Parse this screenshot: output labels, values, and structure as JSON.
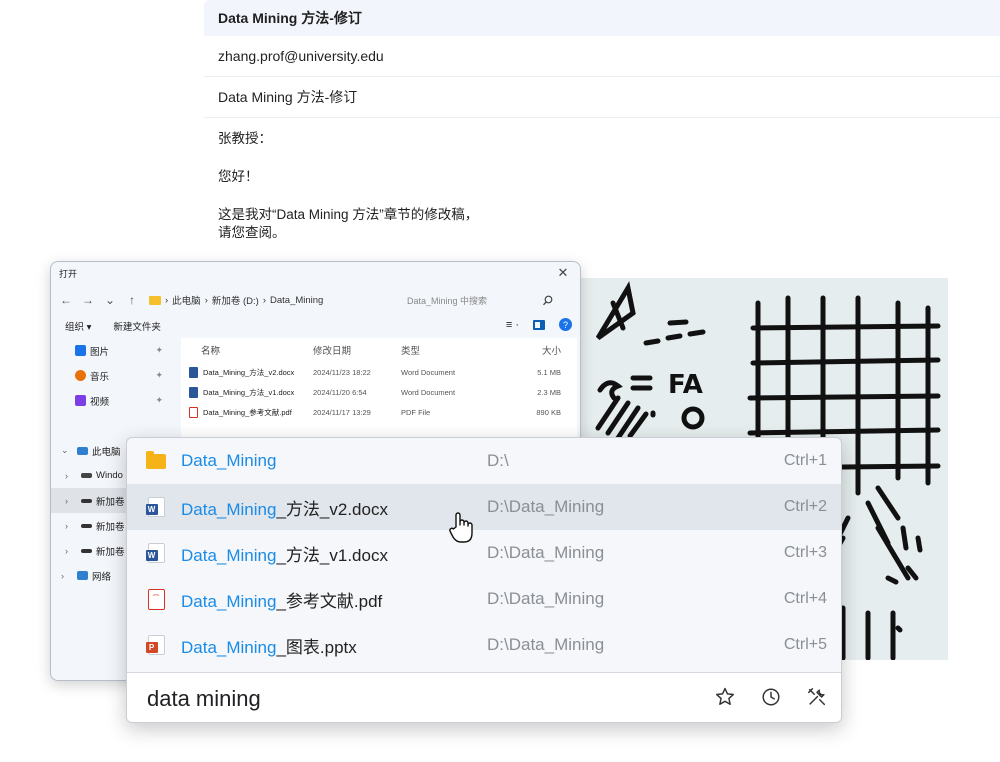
{
  "email": {
    "subject_header": "Data Mining 方法-修订",
    "to": "zhang.prof@university.edu",
    "subject": "Data Mining 方法-修订",
    "body": [
      "张教授：",
      "您好！",
      "这是我对“Data Mining 方法”章节的修改稿，",
      "请您查阅。"
    ]
  },
  "explorer": {
    "title": "打开",
    "close": "✕",
    "nav": {
      "back": "←",
      "forward": "→",
      "down": "⌄",
      "up": "↑"
    },
    "path": [
      "此电脑",
      "新加卷 (D:)",
      "Data_Mining"
    ],
    "search_placeholder": "Data_Mining 中搜索",
    "commands": {
      "organize": "组织 ▾",
      "new_folder": "新建文件夹"
    },
    "quick_access": [
      {
        "label": "图片",
        "color": "#1a73e8"
      },
      {
        "label": "音乐",
        "color": "#e8710a"
      },
      {
        "label": "视频",
        "color": "#7b3fe4"
      }
    ],
    "tree": [
      {
        "label": "此电脑",
        "chev": "⌄"
      },
      {
        "label": "Windo",
        "chev": "›"
      },
      {
        "label": "新加卷",
        "chev": "›",
        "selected": true
      },
      {
        "label": "新加卷",
        "chev": "›"
      },
      {
        "label": "新加卷",
        "chev": "›"
      },
      {
        "label": "网络",
        "chev": "›"
      }
    ],
    "columns": {
      "name": "名称",
      "date": "修改日期",
      "type": "类型",
      "size": "大小"
    },
    "files": [
      {
        "name": "Data_Mining_方法_v2.docx",
        "date": "2024/11/23 18:22",
        "type": "Word Document",
        "size": "5.1 MB",
        "kind": "word"
      },
      {
        "name": "Data_Mining_方法_v1.docx",
        "date": "2024/11/20 6:54",
        "type": "Word Document",
        "size": "2.3 MB",
        "kind": "word"
      },
      {
        "name": "Data_Mining_参考文献.pdf",
        "date": "2024/11/17 13:29",
        "type": "PDF File",
        "size": "890 KB",
        "kind": "pdf"
      }
    ]
  },
  "launcher": {
    "results": [
      {
        "match": "Data_Mining",
        "rest": "",
        "path": "D:\\",
        "shortcut": "Ctrl+1",
        "kind": "folder"
      },
      {
        "match": "Data_Mining",
        "rest": "_方法_v2.docx",
        "path": "D:\\Data_Mining",
        "shortcut": "Ctrl+2",
        "kind": "word",
        "selected": true
      },
      {
        "match": "Data_Mining",
        "rest": "_方法_v1.docx",
        "path": "D:\\Data_Mining",
        "shortcut": "Ctrl+3",
        "kind": "word"
      },
      {
        "match": "Data_Mining",
        "rest": "_参考文献.pdf",
        "path": "D:\\Data_Mining",
        "shortcut": "Ctrl+4",
        "kind": "pdf"
      },
      {
        "match": "Data_Mining",
        "rest": "_图表.pptx",
        "path": "D:\\Data_Mining",
        "shortcut": "Ctrl+5",
        "kind": "ppt"
      }
    ],
    "query": "data mining",
    "toolbar_icons": [
      "star-icon",
      "clock-icon",
      "settings-tools-icon"
    ]
  },
  "sketch_text": "FA",
  "colors": {
    "match": "#1a8be6",
    "folder": "#f5b317",
    "word": "#2b579a",
    "pdf": "#d93025",
    "ppt": "#d24726"
  }
}
